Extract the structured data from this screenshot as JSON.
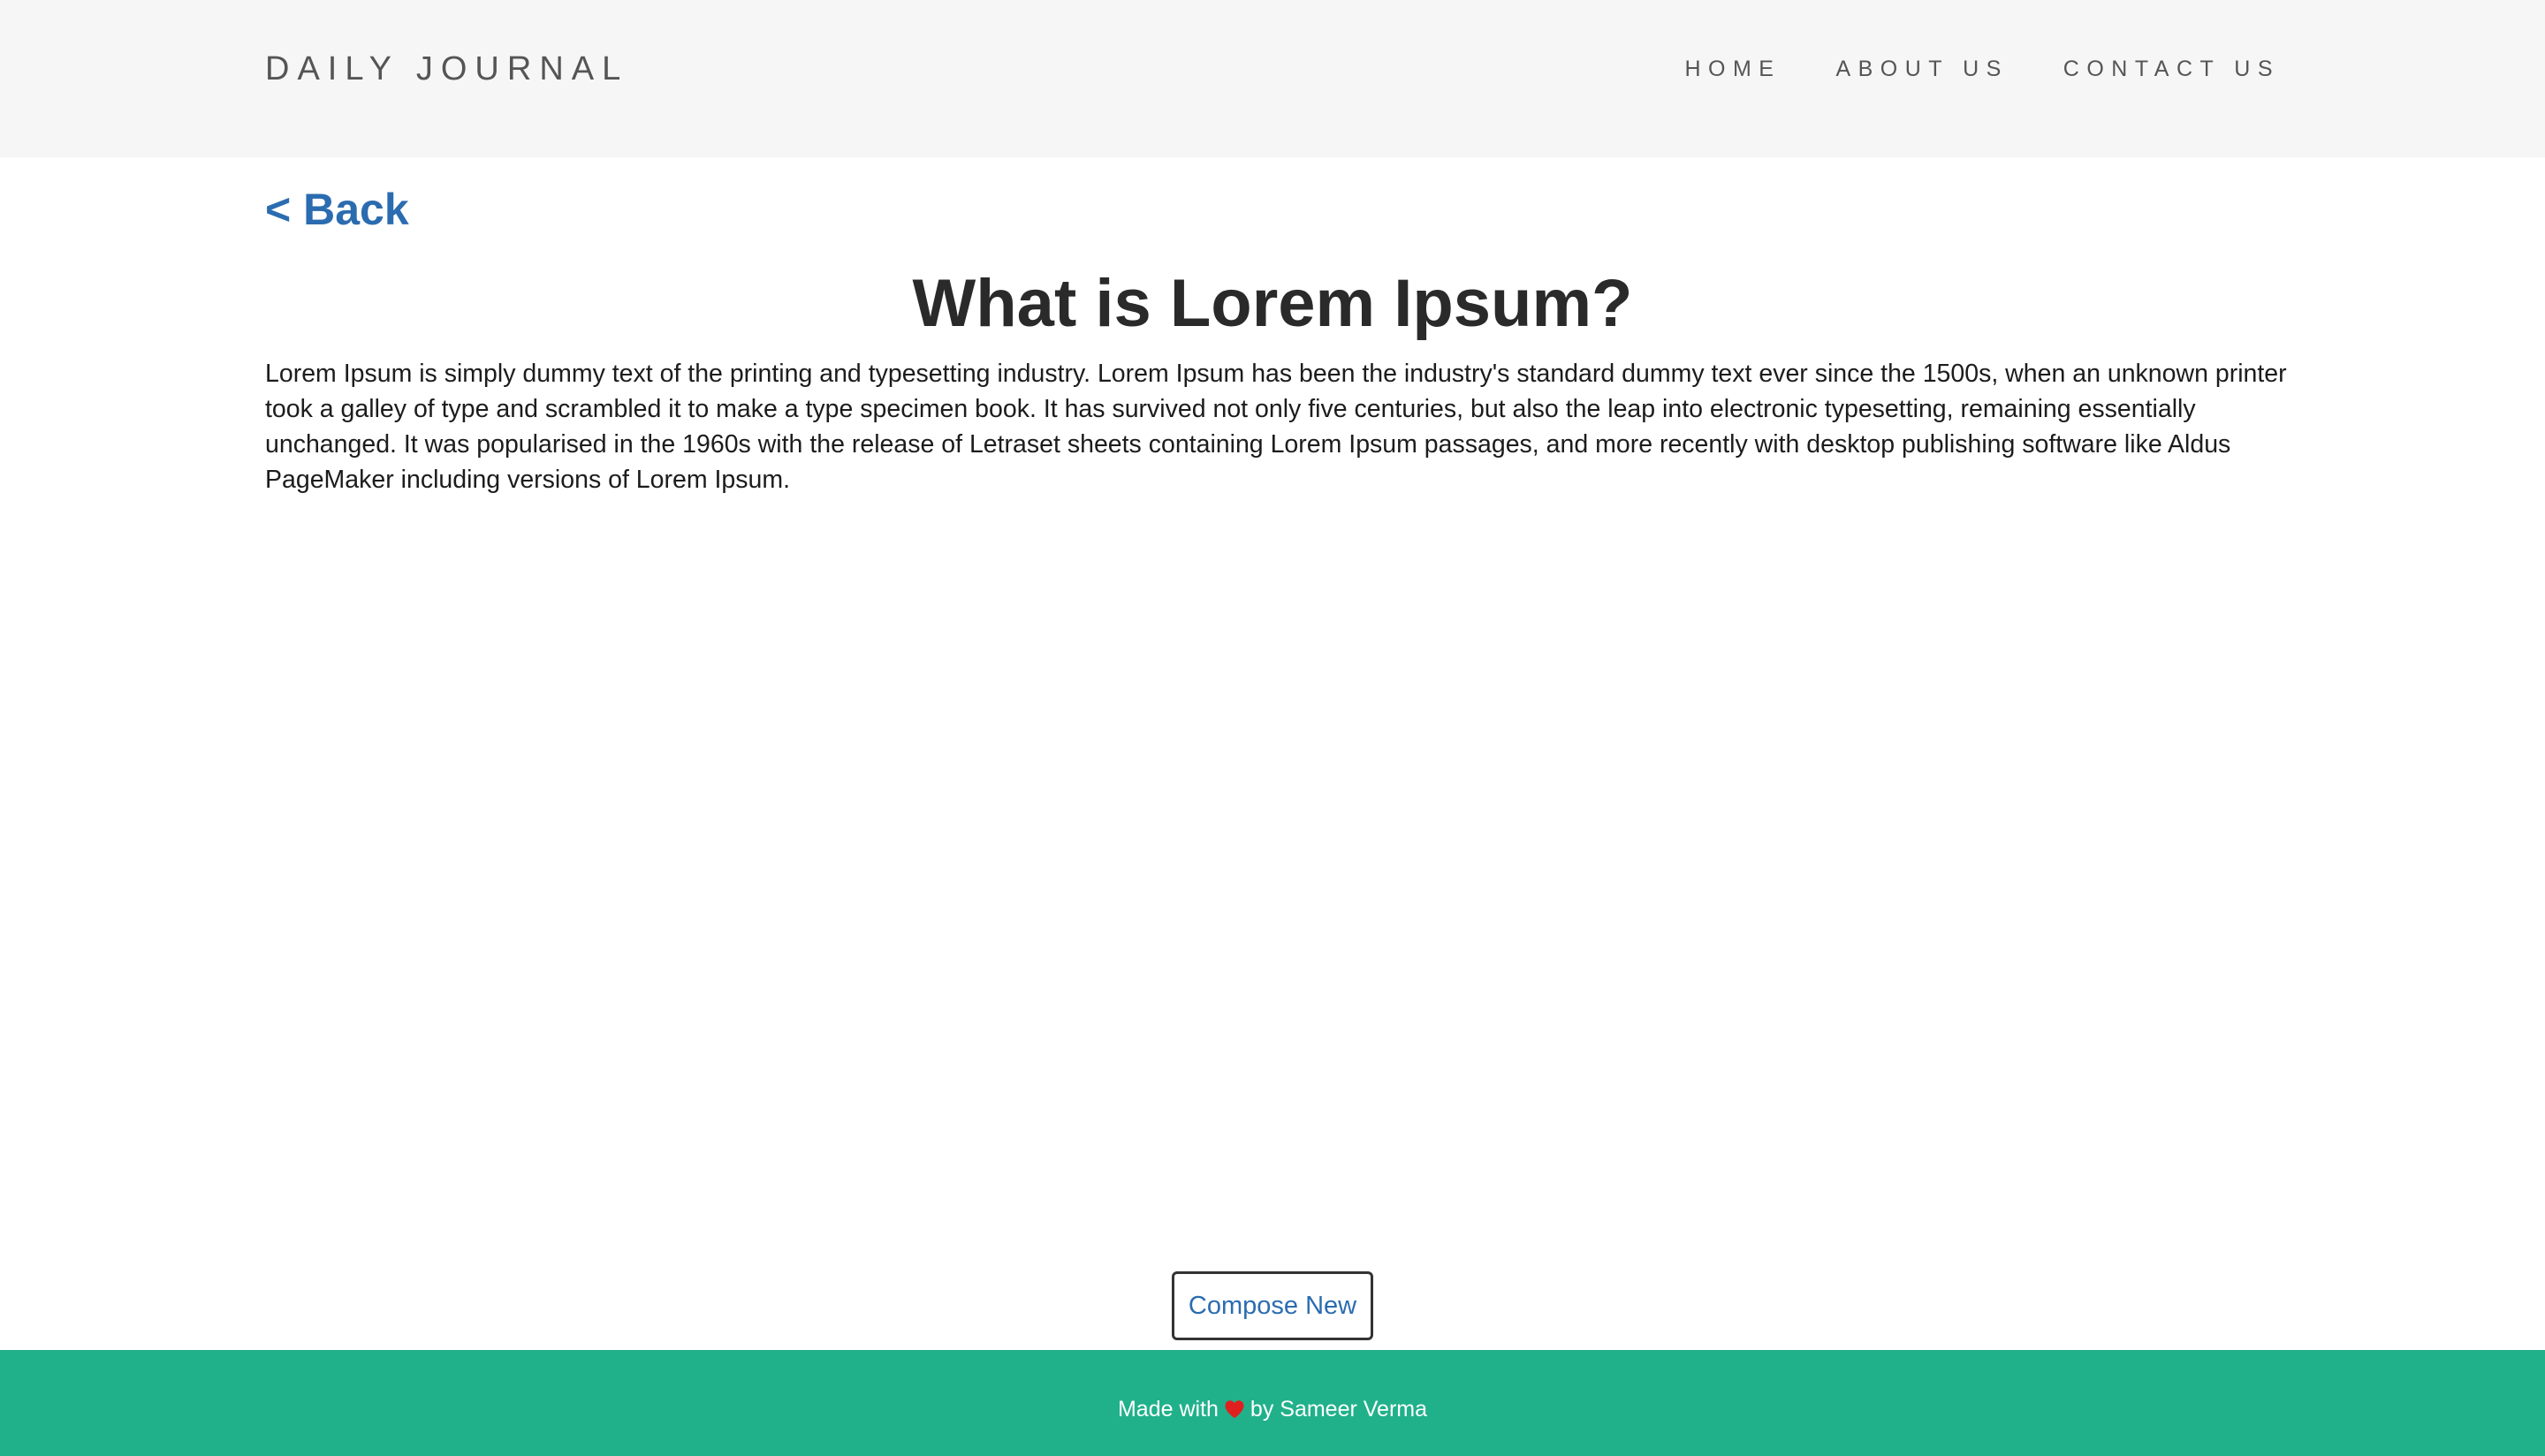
{
  "header": {
    "brand": "DAILY JOURNAL",
    "nav": [
      {
        "label": "HOME"
      },
      {
        "label": "ABOUT US"
      },
      {
        "label": "CONTACT US"
      }
    ]
  },
  "main": {
    "back_label": "< Back",
    "post_title": "What is Lorem Ipsum?",
    "post_body": "Lorem Ipsum is simply dummy text of the printing and typesetting industry. Lorem Ipsum has been the industry's standard dummy text ever since the 1500s, when an unknown printer took a galley of type and scrambled it to make a type specimen book. It has survived not only five centuries, but also the leap into electronic typesetting, remaining essentially unchanged. It was popularised in the 1960s with the release of Letraset sheets containing Lorem Ipsum passages, and more recently with desktop publishing software like Aldus PageMaker including versions of Lorem Ipsum."
  },
  "compose_label": "Compose New",
  "footer": {
    "prefix": "Made with",
    "icon": "heart-icon",
    "suffix": "by Sameer Verma"
  },
  "colors": {
    "header_bg": "#f6f6f6",
    "link": "#2b6cb0",
    "footer_bg": "#20b18b",
    "heart": "#e0201e"
  }
}
